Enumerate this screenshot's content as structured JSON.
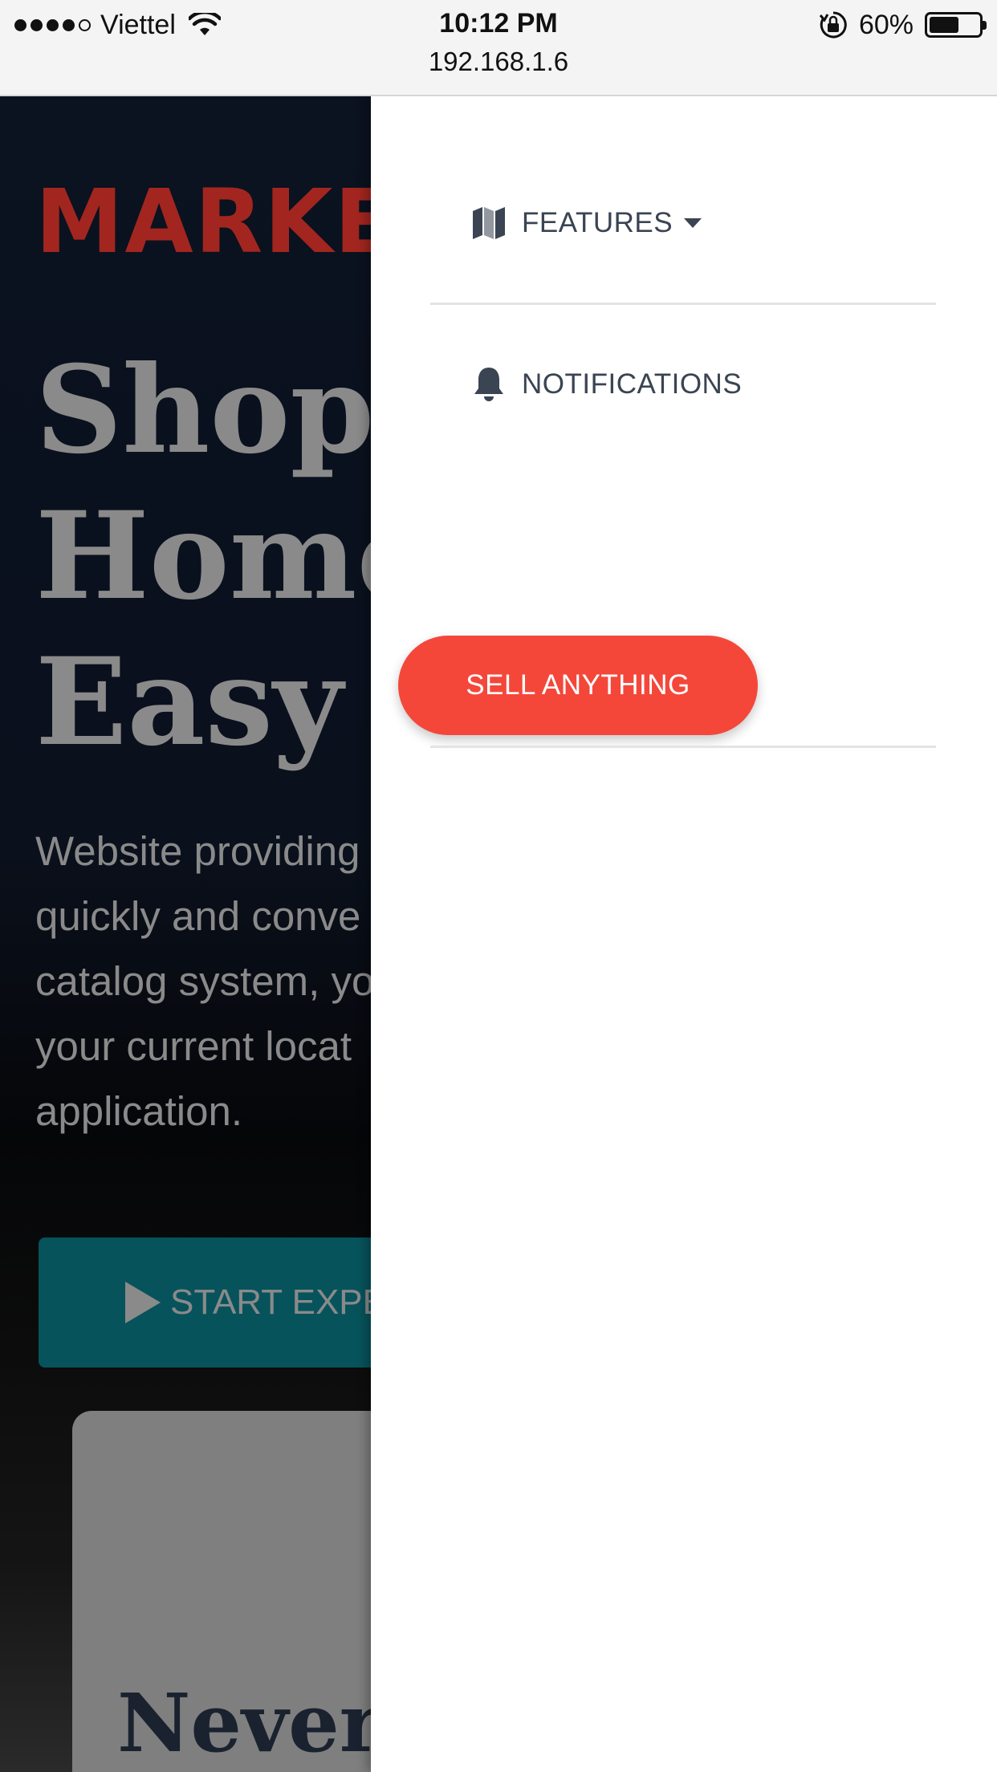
{
  "status_bar": {
    "carrier": "Viettel",
    "time": "10:12 PM",
    "battery_percent": "60%",
    "battery_level": 0.6,
    "url": "192.168.1.6"
  },
  "background_page": {
    "brand": "MARKE",
    "hero_title_lines": [
      "Shopp",
      "Home",
      "Easy"
    ],
    "hero_description_lines": [
      "Website providing",
      "quickly and conve",
      "catalog system, yo",
      "your current locat",
      "application."
    ],
    "cta_label": "START EXPER",
    "card_title": "Never"
  },
  "drawer": {
    "items": [
      {
        "label": "FEATURES",
        "icon": "map-icon",
        "has_dropdown": true
      },
      {
        "label": "NOTIFICATIONS",
        "icon": "bell-icon"
      }
    ],
    "sell_button_label": "SELL ANYTHING"
  },
  "colors": {
    "accent_red": "#f4473a",
    "brand_red": "#a2261f",
    "cta_teal": "#07535c",
    "nav_text": "#3b4452"
  }
}
